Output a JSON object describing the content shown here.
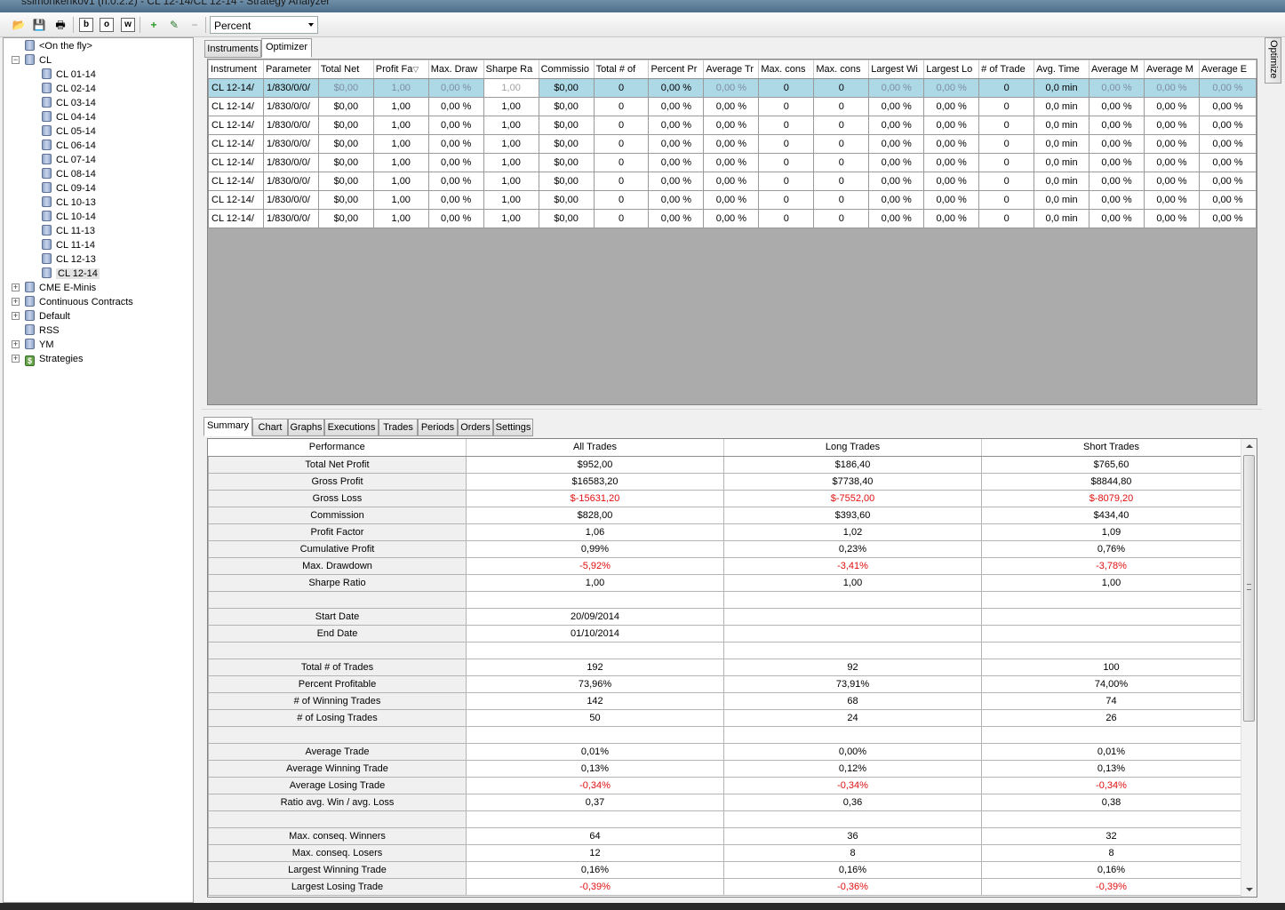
{
  "window": {
    "title": "ssimonkenkov1 (h.0.2.2) - CL 12-14/CL 12-14 - Strategy Analyzer"
  },
  "toolbar": {
    "buttons": [
      {
        "name": "open-icon",
        "glyph": "📂"
      },
      {
        "name": "save-icon",
        "glyph": "💾"
      },
      {
        "name": "print-icon",
        "glyph": "🖶"
      },
      {
        "name": "backtest-icon",
        "glyph": "b"
      },
      {
        "name": "optimize-icon",
        "glyph": "o"
      },
      {
        "name": "walkforward-icon",
        "glyph": "w"
      },
      {
        "name": "add-icon",
        "glyph": "+"
      },
      {
        "name": "edit-icon",
        "glyph": "✎"
      },
      {
        "name": "remove-icon",
        "glyph": "−"
      }
    ],
    "display_mode": "Percent"
  },
  "tree": {
    "items": [
      {
        "label": "<On the fly>",
        "level": 1,
        "expander": "",
        "icon": "db"
      },
      {
        "label": "CL",
        "level": 0,
        "expander": "−",
        "icon": "db"
      },
      {
        "label": "CL 01-14",
        "level": 2,
        "expander": "",
        "icon": "db"
      },
      {
        "label": "CL 02-14",
        "level": 2,
        "expander": "",
        "icon": "db"
      },
      {
        "label": "CL 03-14",
        "level": 2,
        "expander": "",
        "icon": "db"
      },
      {
        "label": "CL 04-14",
        "level": 2,
        "expander": "",
        "icon": "db"
      },
      {
        "label": "CL 05-14",
        "level": 2,
        "expander": "",
        "icon": "db"
      },
      {
        "label": "CL 06-14",
        "level": 2,
        "expander": "",
        "icon": "db"
      },
      {
        "label": "CL 07-14",
        "level": 2,
        "expander": "",
        "icon": "db"
      },
      {
        "label": "CL 08-14",
        "level": 2,
        "expander": "",
        "icon": "db"
      },
      {
        "label": "CL 09-14",
        "level": 2,
        "expander": "",
        "icon": "db"
      },
      {
        "label": "CL 10-13",
        "level": 2,
        "expander": "",
        "icon": "db"
      },
      {
        "label": "CL 10-14",
        "level": 2,
        "expander": "",
        "icon": "db"
      },
      {
        "label": "CL 11-13",
        "level": 2,
        "expander": "",
        "icon": "db"
      },
      {
        "label": "CL 11-14",
        "level": 2,
        "expander": "",
        "icon": "db"
      },
      {
        "label": "CL 12-13",
        "level": 2,
        "expander": "",
        "icon": "db"
      },
      {
        "label": "CL 12-14",
        "level": 2,
        "expander": "",
        "icon": "db",
        "selected": true
      },
      {
        "label": "CME E-Minis",
        "level": 0,
        "expander": "+",
        "icon": "db"
      },
      {
        "label": "Continuous Contracts",
        "level": 0,
        "expander": "+",
        "icon": "db"
      },
      {
        "label": "Default",
        "level": 0,
        "expander": "+",
        "icon": "db"
      },
      {
        "label": "RSS",
        "level": 0,
        "expander": "",
        "icon": "db"
      },
      {
        "label": "YM",
        "level": 0,
        "expander": "+",
        "icon": "db"
      },
      {
        "label": "Strategies",
        "level": 0,
        "expander": "+",
        "icon": "dollar"
      }
    ]
  },
  "top_tabs": [
    "Instruments",
    "Optimizer"
  ],
  "optimizer_side_tab": "Optimize",
  "optimizer": {
    "columns": [
      "Instrument",
      "Parameter",
      "Total Net",
      "Profit Fa",
      "Max. Draw",
      "Sharpe Ra",
      "Commissio",
      "Total # of",
      "Percent Pr",
      "Average Tr",
      "Max. cons",
      "Max. cons",
      "Largest Wi",
      "Largest Lo",
      "# of Trade",
      "Avg. Time",
      "Average M",
      "Average M",
      "Average E"
    ],
    "sort_indicator": "▽",
    "rows": [
      [
        "CL 12-14/",
        "1/830/0/0/",
        "$0,00",
        "1,00",
        "0,00 %",
        "1,00",
        "$0,00",
        "0",
        "0,00 %",
        "0,00 %",
        "0",
        "0",
        "0,00 %",
        "0,00 %",
        "0",
        "0,0 min",
        "0,00 %",
        "0,00 %",
        "0,00 %"
      ],
      [
        "CL 12-14/",
        "1/830/0/0/",
        "$0,00",
        "1,00",
        "0,00 %",
        "1,00",
        "$0,00",
        "0",
        "0,00 %",
        "0,00 %",
        "0",
        "0",
        "0,00 %",
        "0,00 %",
        "0",
        "0,0 min",
        "0,00 %",
        "0,00 %",
        "0,00 %"
      ],
      [
        "CL 12-14/",
        "1/830/0/0/",
        "$0,00",
        "1,00",
        "0,00 %",
        "1,00",
        "$0,00",
        "0",
        "0,00 %",
        "0,00 %",
        "0",
        "0",
        "0,00 %",
        "0,00 %",
        "0",
        "0,0 min",
        "0,00 %",
        "0,00 %",
        "0,00 %"
      ],
      [
        "CL 12-14/",
        "1/830/0/0/",
        "$0,00",
        "1,00",
        "0,00 %",
        "1,00",
        "$0,00",
        "0",
        "0,00 %",
        "0,00 %",
        "0",
        "0",
        "0,00 %",
        "0,00 %",
        "0",
        "0,0 min",
        "0,00 %",
        "0,00 %",
        "0,00 %"
      ],
      [
        "CL 12-14/",
        "1/830/0/0/",
        "$0,00",
        "1,00",
        "0,00 %",
        "1,00",
        "$0,00",
        "0",
        "0,00 %",
        "0,00 %",
        "0",
        "0",
        "0,00 %",
        "0,00 %",
        "0",
        "0,0 min",
        "0,00 %",
        "0,00 %",
        "0,00 %"
      ],
      [
        "CL 12-14/",
        "1/830/0/0/",
        "$0,00",
        "1,00",
        "0,00 %",
        "1,00",
        "$0,00",
        "0",
        "0,00 %",
        "0,00 %",
        "0",
        "0",
        "0,00 %",
        "0,00 %",
        "0",
        "0,0 min",
        "0,00 %",
        "0,00 %",
        "0,00 %"
      ],
      [
        "CL 12-14/",
        "1/830/0/0/",
        "$0,00",
        "1,00",
        "0,00 %",
        "1,00",
        "$0,00",
        "0",
        "0,00 %",
        "0,00 %",
        "0",
        "0",
        "0,00 %",
        "0,00 %",
        "0",
        "0,0 min",
        "0,00 %",
        "0,00 %",
        "0,00 %"
      ],
      [
        "CL 12-14/",
        "1/830/0/0/",
        "$0,00",
        "1,00",
        "0,00 %",
        "1,00",
        "$0,00",
        "0",
        "0,00 %",
        "0,00 %",
        "0",
        "0",
        "0,00 %",
        "0,00 %",
        "0",
        "0,0 min",
        "0,00 %",
        "0,00 %",
        "0,00 %"
      ]
    ]
  },
  "bottom_tabs": [
    "Summary",
    "Chart",
    "Graphs",
    "Executions",
    "Trades",
    "Periods",
    "Orders",
    "Settings"
  ],
  "summary": {
    "columns": [
      "Performance",
      "All Trades",
      "Long Trades",
      "Short Trades"
    ],
    "rows": [
      {
        "label": "Total Net Profit",
        "values": [
          "$952,00",
          "$186,40",
          "$765,60"
        ],
        "neg": false
      },
      {
        "label": "Gross Profit",
        "values": [
          "$16583,20",
          "$7738,40",
          "$8844,80"
        ],
        "neg": false
      },
      {
        "label": "Gross Loss",
        "values": [
          "$-15631,20",
          "$-7552,00",
          "$-8079,20"
        ],
        "neg": true
      },
      {
        "label": "Commission",
        "values": [
          "$828,00",
          "$393,60",
          "$434,40"
        ],
        "neg": false
      },
      {
        "label": "Profit Factor",
        "values": [
          "1,06",
          "1,02",
          "1,09"
        ],
        "neg": false
      },
      {
        "label": "Cumulative Profit",
        "values": [
          "0,99%",
          "0,23%",
          "0,76%"
        ],
        "neg": false
      },
      {
        "label": "Max. Drawdown",
        "values": [
          "-5,92%",
          "-3,41%",
          "-3,78%"
        ],
        "neg": true
      },
      {
        "label": "Sharpe Ratio",
        "values": [
          "1,00",
          "1,00",
          "1,00"
        ],
        "neg": false
      },
      {
        "label": "",
        "values": [
          "",
          "",
          ""
        ],
        "neg": false
      },
      {
        "label": "Start Date",
        "values": [
          "20/09/2014",
          "",
          ""
        ],
        "neg": false
      },
      {
        "label": "End Date",
        "values": [
          "01/10/2014",
          "",
          ""
        ],
        "neg": false
      },
      {
        "label": "",
        "values": [
          "",
          "",
          ""
        ],
        "neg": false
      },
      {
        "label": "Total # of Trades",
        "values": [
          "192",
          "92",
          "100"
        ],
        "neg": false
      },
      {
        "label": "Percent Profitable",
        "values": [
          "73,96%",
          "73,91%",
          "74,00%"
        ],
        "neg": false
      },
      {
        "label": "# of Winning Trades",
        "values": [
          "142",
          "68",
          "74"
        ],
        "neg": false
      },
      {
        "label": "# of Losing Trades",
        "values": [
          "50",
          "24",
          "26"
        ],
        "neg": false
      },
      {
        "label": "",
        "values": [
          "",
          "",
          ""
        ],
        "neg": false
      },
      {
        "label": "Average Trade",
        "values": [
          "0,01%",
          "0,00%",
          "0,01%"
        ],
        "neg": false
      },
      {
        "label": "Average Winning Trade",
        "values": [
          "0,13%",
          "0,12%",
          "0,13%"
        ],
        "neg": false
      },
      {
        "label": "Average Losing Trade",
        "values": [
          "-0,34%",
          "-0,34%",
          "-0,34%"
        ],
        "neg": true
      },
      {
        "label": "Ratio avg. Win / avg. Loss",
        "values": [
          "0,37",
          "0,36",
          "0,38"
        ],
        "neg": false
      },
      {
        "label": "",
        "values": [
          "",
          "",
          ""
        ],
        "neg": false
      },
      {
        "label": "Max. conseq. Winners",
        "values": [
          "64",
          "36",
          "32"
        ],
        "neg": false
      },
      {
        "label": "Max. conseq. Losers",
        "values": [
          "12",
          "8",
          "8"
        ],
        "neg": false
      },
      {
        "label": "Largest Winning Trade",
        "values": [
          "0,16%",
          "0,16%",
          "0,16%"
        ],
        "neg": false
      },
      {
        "label": "Largest Losing Trade",
        "values": [
          "-0,39%",
          "-0,36%",
          "-0,39%"
        ],
        "neg": true
      }
    ]
  },
  "colors": {
    "selected_row": "#add8e6",
    "negative": "#e01010",
    "grid_empty": "#ababab"
  }
}
